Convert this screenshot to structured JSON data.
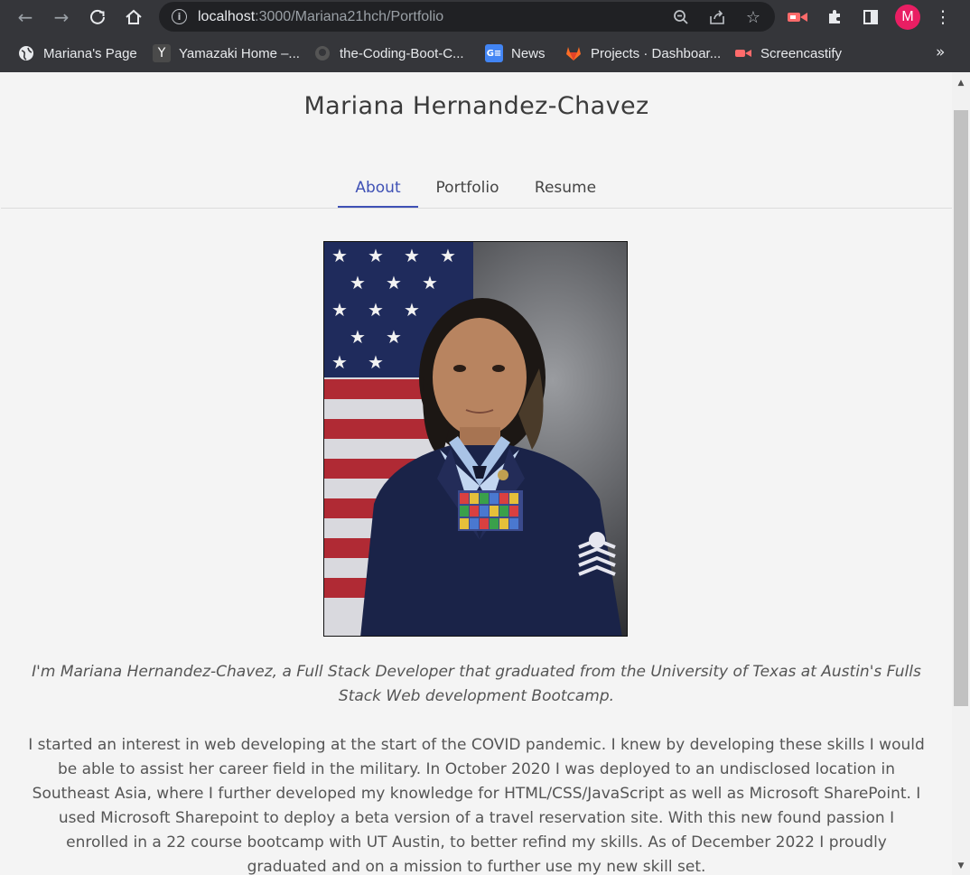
{
  "browser": {
    "url_host": "localhost",
    "url_path": ":3000/Mariana21hch/Portfolio",
    "profile_initial": "M",
    "bookmarks": [
      {
        "label": "Mariana's Page",
        "icon": "globe-icon"
      },
      {
        "label": "Yamazaki Home –...",
        "icon": "y-icon"
      },
      {
        "label": "the-Coding-Boot-C...",
        "icon": "github-icon"
      },
      {
        "label": "News",
        "icon": "google-news-icon"
      },
      {
        "label": "Projects · Dashboar...",
        "icon": "gitlab-icon"
      },
      {
        "label": "Screencastify",
        "icon": "screencastify-icon"
      }
    ],
    "more_bookmarks": "»"
  },
  "site": {
    "title": "Mariana Hernandez-Chavez",
    "tabs": [
      {
        "label": "About",
        "active": true
      },
      {
        "label": "Portfolio",
        "active": false
      },
      {
        "label": "Resume",
        "active": false
      }
    ]
  },
  "about": {
    "intro": "I'm Mariana Hernandez-Chavez, a Full Stack Developer that graduated from the University of Texas at Austin's Fulls Stack Web development Bootcamp.",
    "bio": "I started an interest in web developing at the start of the COVID pandemic. I knew by developing these skills I would be able to assist her career field in the military. In October 2020 I was deployed to an undisclosed location in Southeast Asia, where I further developed my knowledge for HTML/CSS/JavaScript as well as Microsoft SharePoint. I used Microsoft Sharepoint to deploy a beta version of a travel reservation site. With this new found passion I enrolled in a 22 course bootcamp with UT Austin, to better refind my skills. As of December 2022 I proudly graduated and on a mission to further use my new skill set."
  },
  "colors": {
    "accent": "#3f51b5",
    "avatar": "#e91e63",
    "page_bg": "#f4f4f4"
  }
}
